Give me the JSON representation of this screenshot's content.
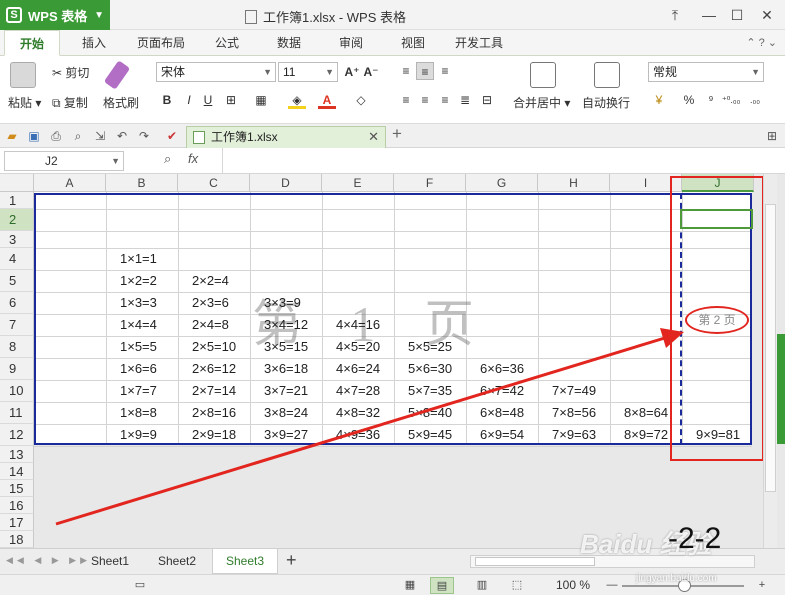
{
  "app": {
    "name": "WPS 表格"
  },
  "window": {
    "title": "工作簿1.xlsx - WPS 表格",
    "icons": [
      "restore-ribbon-icon",
      "minimize-icon",
      "maximize-icon",
      "close-icon"
    ]
  },
  "tabs": [
    "开始",
    "插入",
    "页面布局",
    "公式",
    "数据",
    "审阅",
    "视图",
    "开发工具"
  ],
  "ribbon": {
    "paste_label": "粘贴",
    "cut_label": "剪切",
    "copy_label": "复制",
    "format_painter_label": "格式刷",
    "font_name": "宋体",
    "font_size": "11",
    "merge_center_label": "合并居中",
    "wrap_text_label": "自动换行",
    "number_format": "常规",
    "increase_font": "A⁺",
    "decrease_font": "A⁻",
    "bold": "B",
    "italic": "I",
    "underline": "U",
    "percent": "%",
    "comma": "⁹",
    "dec_inc": "⁺⁰.₀₀",
    "dec_dec": ".₀₀"
  },
  "doc_tab": {
    "name": "工作簿1.xlsx"
  },
  "formula_bar": {
    "name_box": "J2",
    "fx": "fx",
    "formula": ""
  },
  "columns": [
    "A",
    "B",
    "C",
    "D",
    "E",
    "F",
    "G",
    "H",
    "I",
    "J"
  ],
  "rows": [
    "1",
    "2",
    "3",
    "4",
    "5",
    "6",
    "7",
    "8",
    "9",
    "10",
    "11",
    "12",
    "13",
    "14",
    "15",
    "16",
    "17",
    "18"
  ],
  "cells": [
    [
      "1×1=1"
    ],
    [
      "1×2=2",
      "2×2=4"
    ],
    [
      "1×3=3",
      "2×3=6",
      "3×3=9"
    ],
    [
      "1×4=4",
      "2×4=8",
      "3×4=12",
      "4×4=16"
    ],
    [
      "1×5=5",
      "2×5=10",
      "3×5=15",
      "4×5=20",
      "5×5=25"
    ],
    [
      "1×6=6",
      "2×6=12",
      "3×6=18",
      "4×6=24",
      "5×6=30",
      "6×6=36"
    ],
    [
      "1×7=7",
      "2×7=14",
      "3×7=21",
      "4×7=28",
      "5×7=35",
      "6×7=42",
      "7×7=49"
    ],
    [
      "1×8=8",
      "2×8=16",
      "3×8=24",
      "4×8=32",
      "5×8=40",
      "6×8=48",
      "7×8=56",
      "8×8=64"
    ],
    [
      "1×9=9",
      "2×9=18",
      "3×9=27",
      "4×9=36",
      "5×9=45",
      "6×9=54",
      "7×9=63",
      "8×9=72",
      "9×9=81"
    ]
  ],
  "watermark_page1": "第 1 页",
  "annotation_page2": "第 2 页",
  "sheets": [
    "Sheet1",
    "Sheet2",
    "Sheet3"
  ],
  "active_sheet": "Sheet3",
  "status": {
    "zoom": "100 %"
  },
  "overlay_text": "-2-2",
  "baidu_watermark": "Baidu 经验",
  "baidu_url": "jingyan.baidu.com",
  "colors": {
    "brand_green": "#3a9a35",
    "print_border": "#1b2a9a",
    "annotation_red": "#e2261f"
  }
}
